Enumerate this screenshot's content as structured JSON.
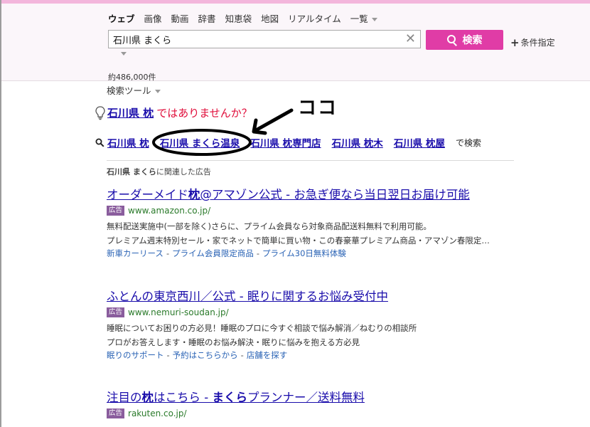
{
  "tabs": [
    {
      "label": "ウェブ",
      "active": true
    },
    {
      "label": "画像"
    },
    {
      "label": "動画"
    },
    {
      "label": "辞書"
    },
    {
      "label": "知恵袋"
    },
    {
      "label": "地図"
    },
    {
      "label": "リアルタイム"
    },
    {
      "label": "一覧",
      "dropdown": true
    }
  ],
  "search": {
    "query": "石川県 まくら",
    "clear_icon": "close-icon",
    "button_label": "検索",
    "button_icon": "search-icon",
    "condition_label": "条件指定"
  },
  "result_count": "約486,000件",
  "tools_label": "検索ツール",
  "suggestion": {
    "icon": "lightbulb-icon",
    "query": "石川県 枕",
    "tail": "ではありませんか？"
  },
  "annotation": {
    "text": "ココ"
  },
  "related": {
    "icon": "search-icon",
    "items": [
      "石川県 枕",
      "石川県 まくら温泉",
      "石川県 枕専門店",
      "石川県 枕木",
      "石川県 枕屋"
    ],
    "after": "で検索"
  },
  "ads_header": {
    "query": "石川県 まくら",
    "suffix": "に関連した広告"
  },
  "ads": [
    {
      "title_pre": "オーダーメイド",
      "title_bold": "枕",
      "title_post": "@アマゾン公式 - お急ぎ便なら当日翌日お届け可能",
      "badge": "広告",
      "url": "www.amazon.co.jp/",
      "desc1": "無料配送実施中(一部を除く)さらに、プライム会員なら対象商品配送料無料で利用可能。",
      "desc2": "プレミアム週末特別セール・家でネットで簡単に買い物・この春豪華プレミアム商品・アマゾン春限定…",
      "links": [
        "新車カーリース",
        "プライム会員限定商品",
        "プライム30日無料体験"
      ]
    },
    {
      "title_pre": "ふとんの東京西川／公式 - 眠りに関するお悩み受付中",
      "title_bold": "",
      "title_post": "",
      "badge": "広告",
      "url": "www.nemuri-soudan.jp/",
      "desc1": "睡眠についてお困りの方必見！睡眠のプロに今すぐ相談で悩み解消／ねむりの相談所",
      "desc2": "プロがお答えします・睡眠のお悩み解決・眠りに悩みを抱える方必見",
      "links": [
        "眠りのサポート",
        "予約はこちらから",
        "店舗を探す"
      ]
    },
    {
      "title_pre": "注目の",
      "title_bold": "枕",
      "title_mid": "はこちら - ",
      "title_bold2": "まくら",
      "title_post": "プランナー／送料無料",
      "badge": "広告",
      "url": "rakuten.co.jp/"
    }
  ],
  "colors": {
    "accent": "#e03ca6",
    "top_strip": "#f3b6dc",
    "link": "#1a0dab",
    "url_green": "#2a7a2a",
    "suggest_red": "#e00d3a",
    "ad_badge": "#8a5d9d",
    "sitelinks": "#2a63b5"
  }
}
